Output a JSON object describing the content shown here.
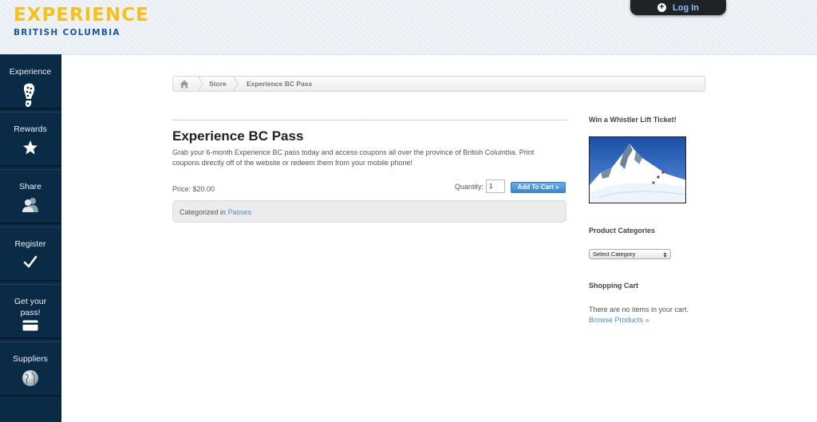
{
  "header": {
    "logo_line1": "EXPERIENCE",
    "logo_line2": "BRITISH COLUMBIA",
    "login_label": "Log In",
    "login_icon": "plus-circle-icon"
  },
  "sidebar": {
    "items": [
      {
        "label": "Experience",
        "icon": "boot-print-icon"
      },
      {
        "label": "Rewards",
        "icon": "star-icon"
      },
      {
        "label": "Share",
        "icon": "people-icon"
      },
      {
        "label": "Register",
        "icon": "checkmark-icon"
      },
      {
        "label": "Get your pass!",
        "icon": "credit-card-icon"
      },
      {
        "label": "Suppliers",
        "icon": "globe-icon"
      }
    ]
  },
  "breadcrumb": {
    "home_icon": "home-icon",
    "items": [
      "Store",
      "Experience BC Pass"
    ]
  },
  "product": {
    "title": "Experience BC Pass",
    "description": "Grab your 6-month Experience BC pass today and access coupons all over the province of British Columbia. Print coupons directly off of the website or redeem them from your mobile phone!",
    "price": "Price: $20.00",
    "quantity_label": "Quantity:",
    "quantity_value": "1",
    "add_to_cart_label": "Add To Cart »",
    "categorized_prefix": "Categorized in",
    "category_link": "Passes"
  },
  "right_sidebar": {
    "promo_heading": "Win a Whistler Lift Ticket!",
    "categories_heading": "Product Categories",
    "category_select_value": "Select Category",
    "cart_heading": "Shopping Cart",
    "cart_empty_text": "There are no items in your cart.",
    "browse_link": "Browse Products »"
  },
  "colors": {
    "sidebar_bg": "#0b2a45",
    "logo_yellow": "#f6c11b",
    "logo_blue": "#1c5896",
    "link_blue": "#4d8cc9",
    "button_blue": "#3c86cc"
  }
}
